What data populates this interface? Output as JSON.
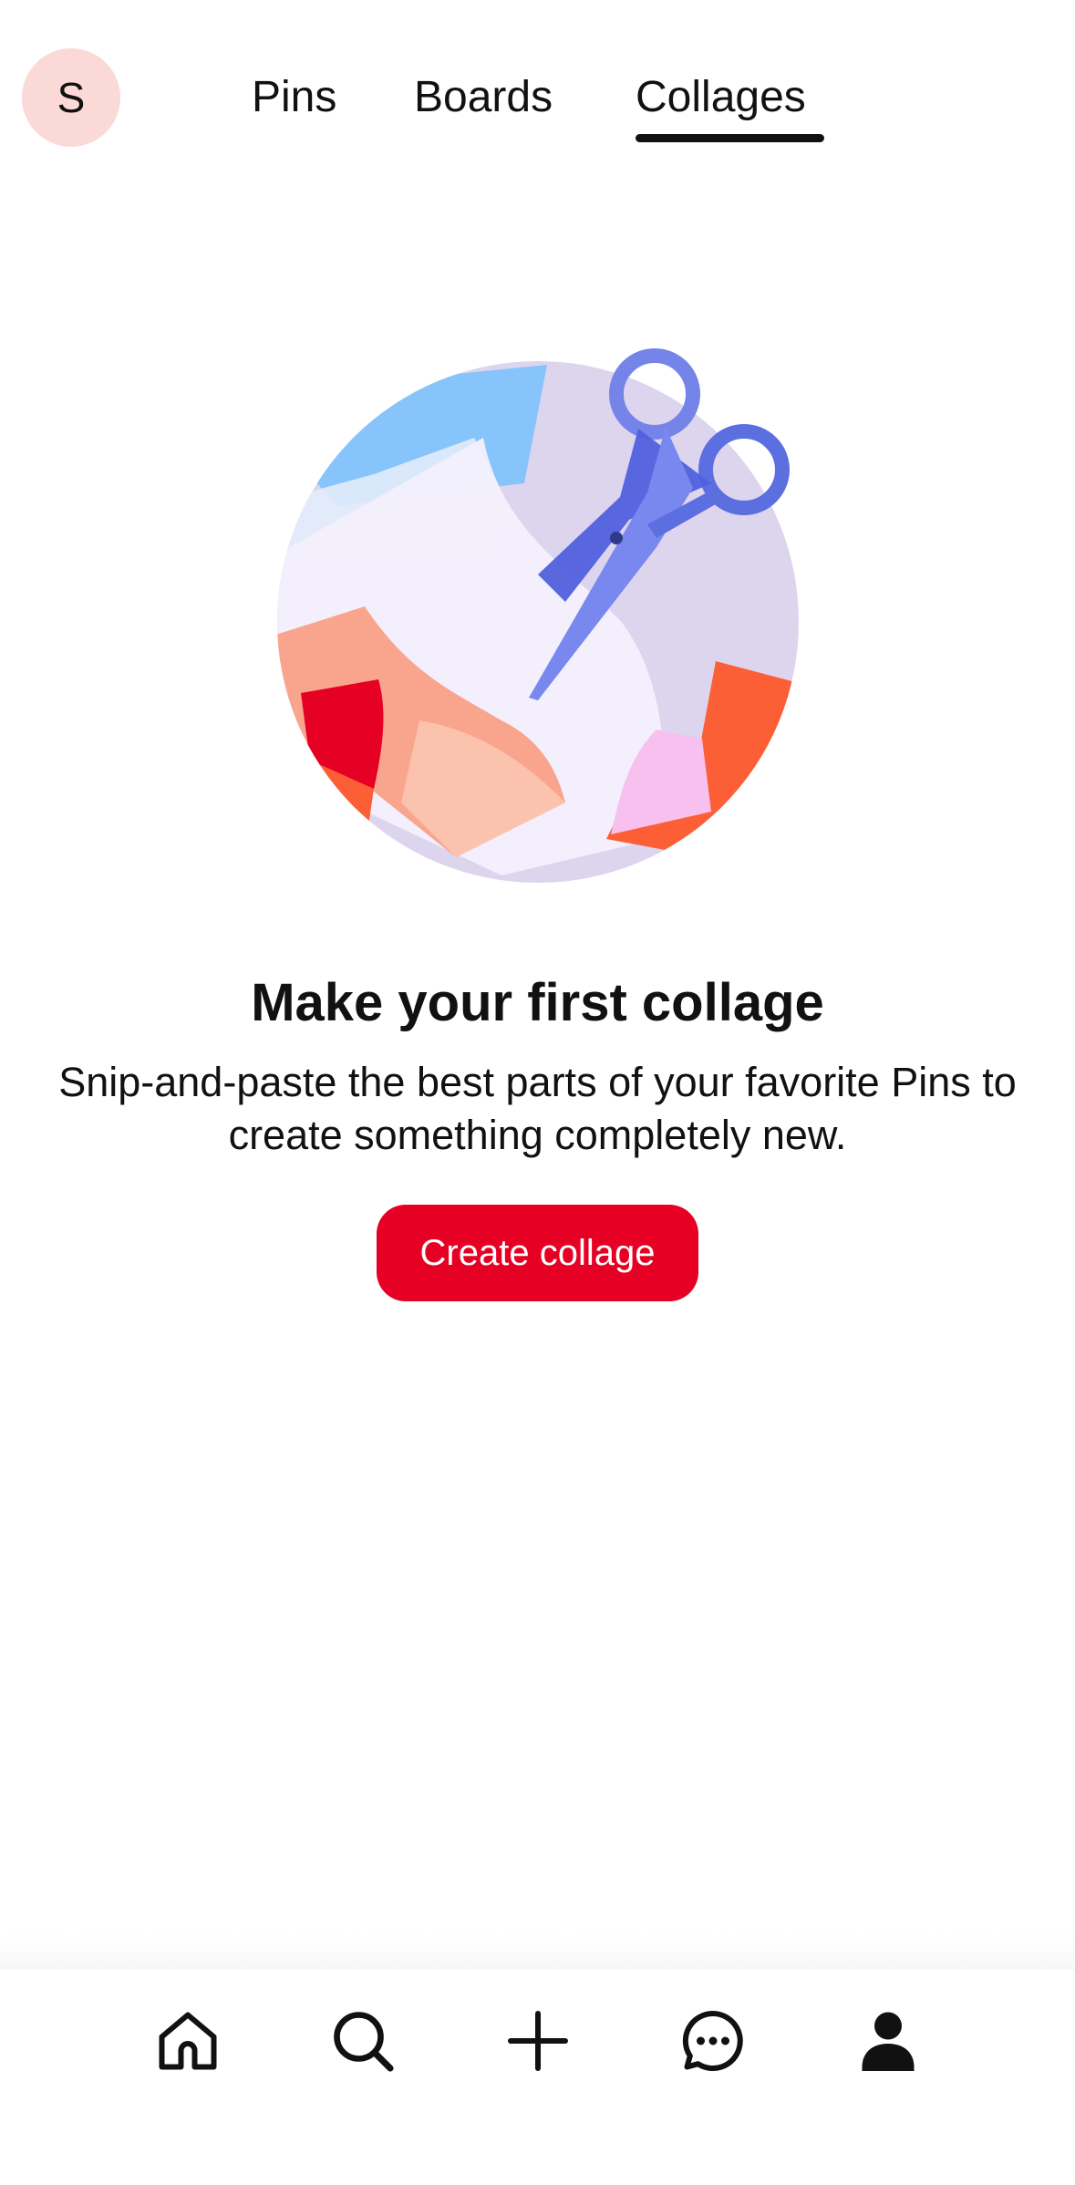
{
  "header": {
    "avatar_initial": "S",
    "tabs": [
      {
        "label": "Pins",
        "active": false
      },
      {
        "label": "Boards",
        "active": false
      },
      {
        "label": "Collages",
        "active": true
      }
    ]
  },
  "empty_state": {
    "title": "Make your first collage",
    "description": "Snip-and-paste the best parts of your favorite Pins to create something completely new.",
    "button_label": "Create collage",
    "illustration": "scissors-collage-illustration"
  },
  "bottom_nav": {
    "items": [
      {
        "name": "home",
        "icon": "home-icon"
      },
      {
        "name": "search",
        "icon": "search-icon"
      },
      {
        "name": "create",
        "icon": "plus-icon"
      },
      {
        "name": "messages",
        "icon": "chat-icon"
      },
      {
        "name": "profile",
        "icon": "person-icon"
      }
    ]
  },
  "colors": {
    "accent_red": "#e60023",
    "avatar_bg": "#fbd9d7",
    "text": "#111111"
  }
}
